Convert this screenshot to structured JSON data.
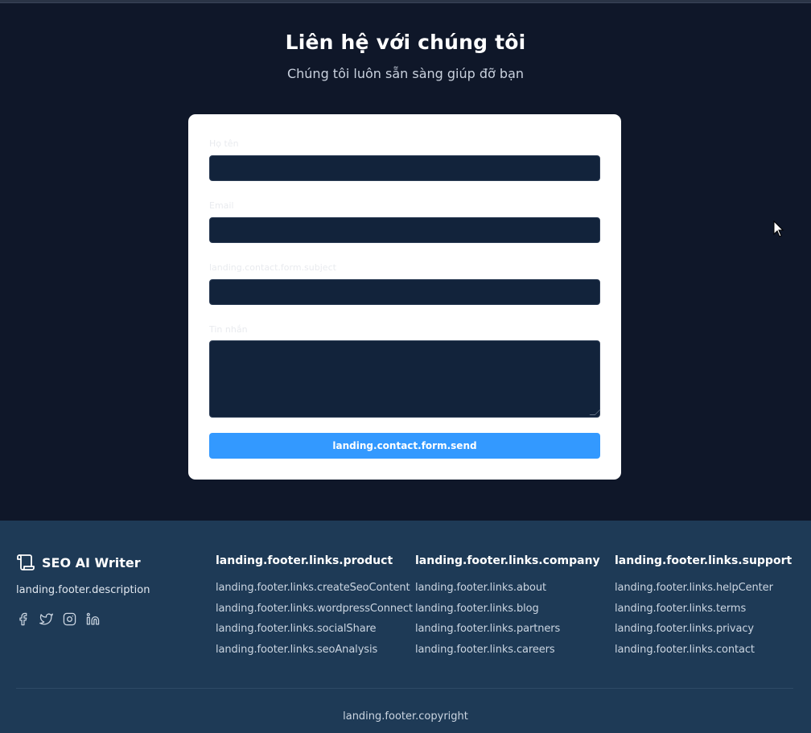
{
  "contact": {
    "title": "Liên hệ với chúng tôi",
    "subtitle": "Chúng tôi luôn sẵn sàng giúp đỡ bạn",
    "form": {
      "name_label": "Họ tên",
      "name_value": "",
      "email_label": "Email",
      "email_value": "",
      "subject_label": "landing.contact.form.subject",
      "subject_value": "",
      "message_label": "Tin nhắn",
      "message_value": "",
      "send_label": "landing.contact.form.send"
    }
  },
  "footer": {
    "brand": "SEO AI Writer",
    "description": "landing.footer.description",
    "social_icons": [
      "facebook-icon",
      "twitter-icon",
      "instagram-icon",
      "linkedin-icon"
    ],
    "columns": [
      {
        "title": "landing.footer.links.product",
        "links": [
          "landing.footer.links.createSeoContent",
          "landing.footer.links.wordpressConnect",
          "landing.footer.links.socialShare",
          "landing.footer.links.seoAnalysis"
        ]
      },
      {
        "title": "landing.footer.links.company",
        "links": [
          "landing.footer.links.about",
          "landing.footer.links.blog",
          "landing.footer.links.partners",
          "landing.footer.links.careers"
        ]
      },
      {
        "title": "landing.footer.links.support",
        "links": [
          "landing.footer.links.helpCenter",
          "landing.footer.links.terms",
          "landing.footer.links.privacy",
          "landing.footer.links.contact"
        ]
      }
    ],
    "copyright": "landing.footer.copyright"
  },
  "colors": {
    "page_bg": "#0f1729",
    "footer_bg": "#1e3a56",
    "input_bg": "#12233b",
    "button_bg": "#3399ff"
  }
}
